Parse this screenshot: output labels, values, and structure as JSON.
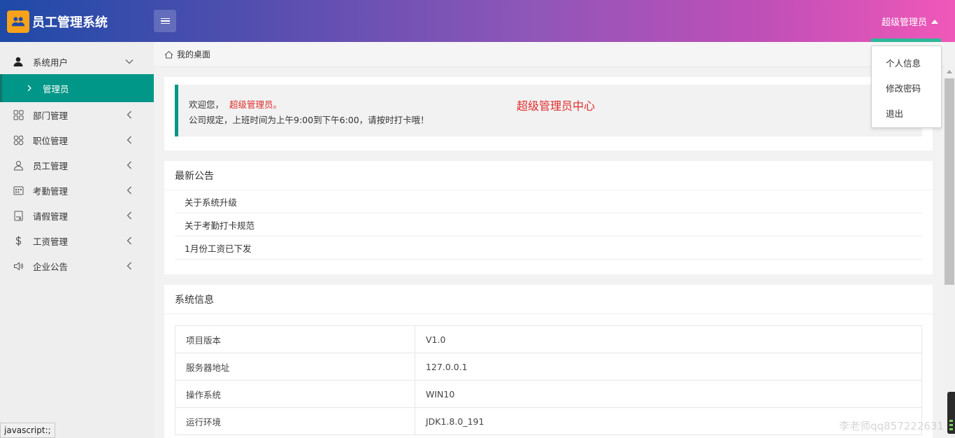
{
  "header": {
    "app_title": "员工管理系统",
    "user_name": "超级管理员",
    "accent_underline": "#2eb89a"
  },
  "sidebar": {
    "items": [
      {
        "label": "系统用户",
        "icon": "user-solid-icon",
        "expanded": true
      },
      {
        "label": "部门管理",
        "icon": "grid-icon"
      },
      {
        "label": "职位管理",
        "icon": "flower-icon"
      },
      {
        "label": "员工管理",
        "icon": "person-icon"
      },
      {
        "label": "考勤管理",
        "icon": "calendar-icon"
      },
      {
        "label": "请假管理",
        "icon": "document-icon"
      },
      {
        "label": "工资管理",
        "icon": "dollar-icon"
      },
      {
        "label": "企业公告",
        "icon": "speaker-icon"
      }
    ],
    "sub_item": {
      "label": "管理员",
      "active_color": "#009688"
    }
  },
  "breadcrumb": {
    "home_label": "我的桌面"
  },
  "welcome": {
    "greeting": "欢迎您，",
    "user": "超级管理员。",
    "rule": "公司规定，上班时间为上午9:00到下午6:00，请按时打卡哦！",
    "center_title": "超级管理员中心"
  },
  "notice": {
    "title": "最新公告",
    "items": [
      "关于系统升级",
      "关于考勤打卡规范",
      "1月份工资已下发"
    ]
  },
  "sysinfo": {
    "title": "系统信息",
    "rows": [
      {
        "key": "项目版本",
        "value": "V1.0"
      },
      {
        "key": "服务器地址",
        "value": "127.0.0.1"
      },
      {
        "key": "操作系统",
        "value": "WIN10"
      },
      {
        "key": "运行环境",
        "value": "JDK1.8.0_191"
      }
    ]
  },
  "dropdown": {
    "items": [
      "个人信息",
      "修改密码",
      "退出"
    ]
  },
  "statusbar": {
    "text": "javascript:;"
  },
  "watermark": "李老师qq857222631"
}
